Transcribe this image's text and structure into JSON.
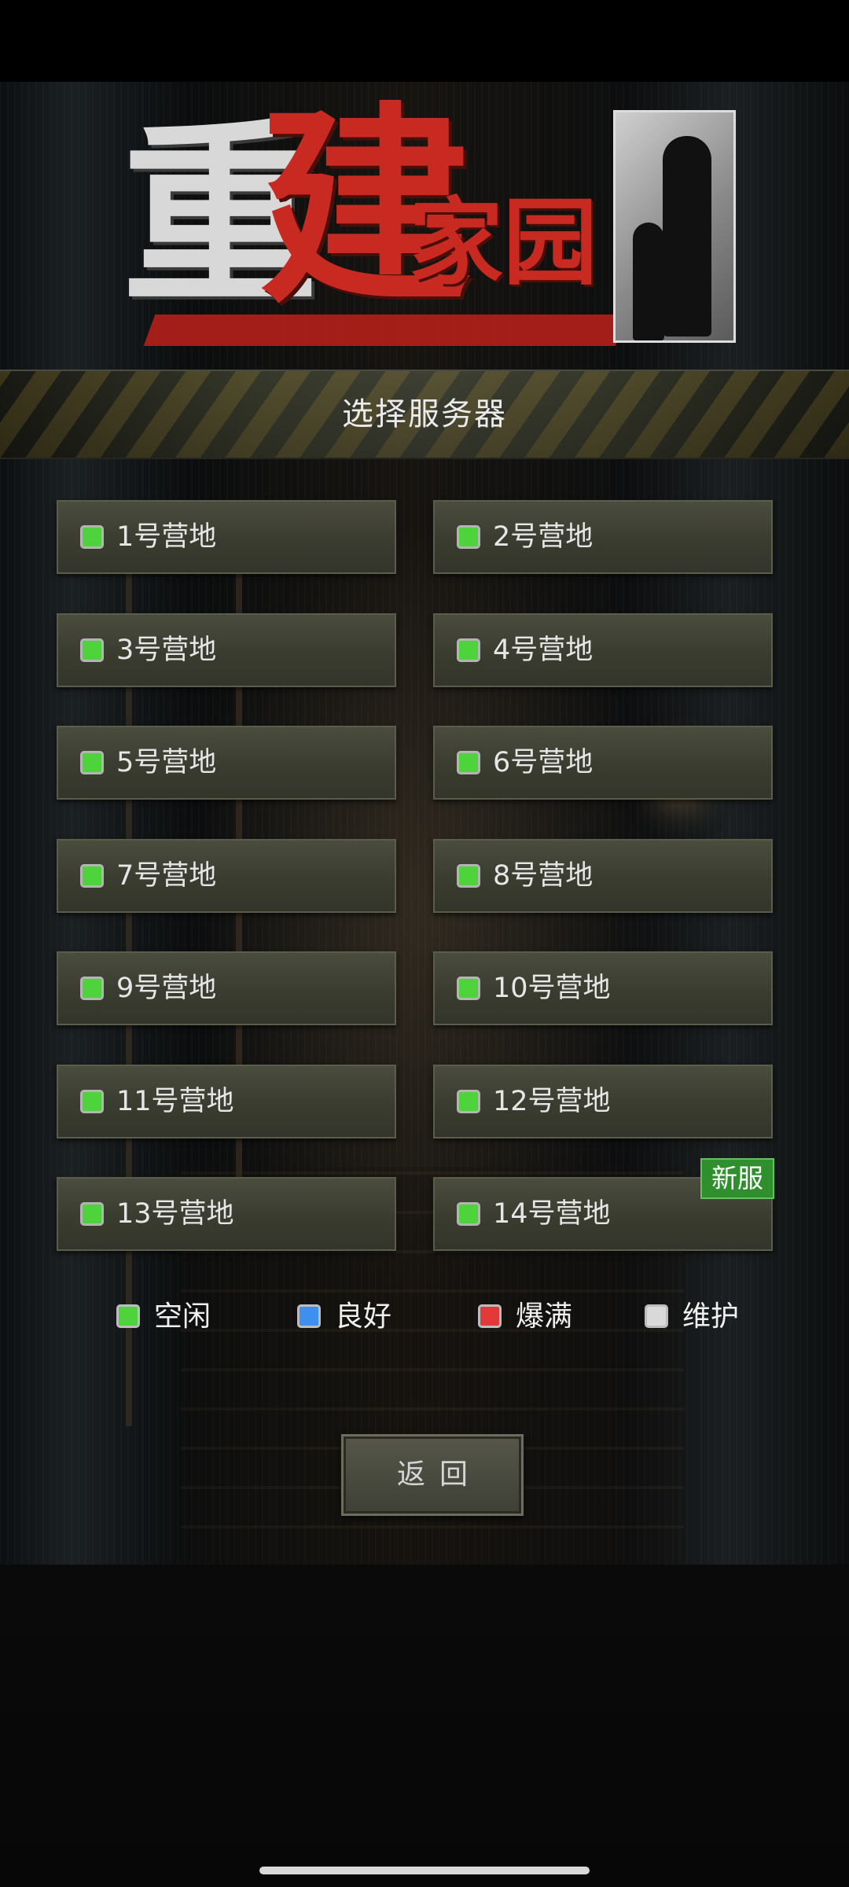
{
  "logo": {
    "chars": [
      "重",
      "建",
      "家园"
    ]
  },
  "header": {
    "title": "选择服务器"
  },
  "servers": [
    {
      "label": "1号营地",
      "status": "空闲"
    },
    {
      "label": "2号营地",
      "status": "空闲"
    },
    {
      "label": "3号营地",
      "status": "空闲"
    },
    {
      "label": "4号营地",
      "status": "空闲"
    },
    {
      "label": "5号营地",
      "status": "空闲"
    },
    {
      "label": "6号营地",
      "status": "空闲"
    },
    {
      "label": "7号营地",
      "status": "空闲"
    },
    {
      "label": "8号营地",
      "status": "空闲"
    },
    {
      "label": "9号营地",
      "status": "空闲"
    },
    {
      "label": "10号营地",
      "status": "空闲"
    },
    {
      "label": "11号营地",
      "status": "空闲"
    },
    {
      "label": "12号营地",
      "status": "空闲"
    },
    {
      "label": "13号营地",
      "status": "空闲"
    },
    {
      "label": "14号营地",
      "status": "空闲",
      "badge": "新服"
    }
  ],
  "legend": [
    {
      "label": "空闲",
      "color": "#4fd33d"
    },
    {
      "label": "良好",
      "color": "#3f8ff0"
    },
    {
      "label": "爆满",
      "color": "#e23a3a"
    },
    {
      "label": "维护",
      "color": "#d9d9d9"
    }
  ],
  "back_button": {
    "label": "返回"
  },
  "colors": {
    "button_bg": "#3b3c30",
    "badge_bg": "#2f8f2c",
    "logo_red": "#c82a21"
  }
}
